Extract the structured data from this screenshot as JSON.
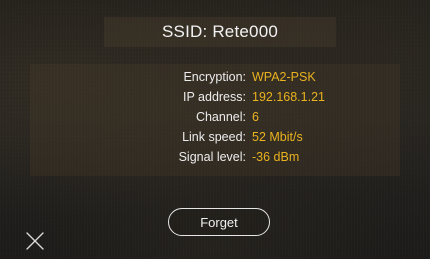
{
  "header": {
    "title": "SSID: Rete000"
  },
  "network_info": {
    "rows": [
      {
        "label": "Encryption:",
        "value": "WPA2-PSK"
      },
      {
        "label": "IP address:",
        "value": "192.168.1.21"
      },
      {
        "label": "Channel:",
        "value": "6"
      },
      {
        "label": "Link speed:",
        "value": "52 Mbit/s"
      },
      {
        "label": "Signal level:",
        "value": "-36 dBm"
      }
    ]
  },
  "actions": {
    "forget_label": "Forget",
    "close_icon": "close-icon"
  },
  "colors": {
    "value_accent": "#e9b21f",
    "label_text": "#ececec",
    "title_text": "#f2f2f2",
    "button_border": "#e6e6e6"
  }
}
